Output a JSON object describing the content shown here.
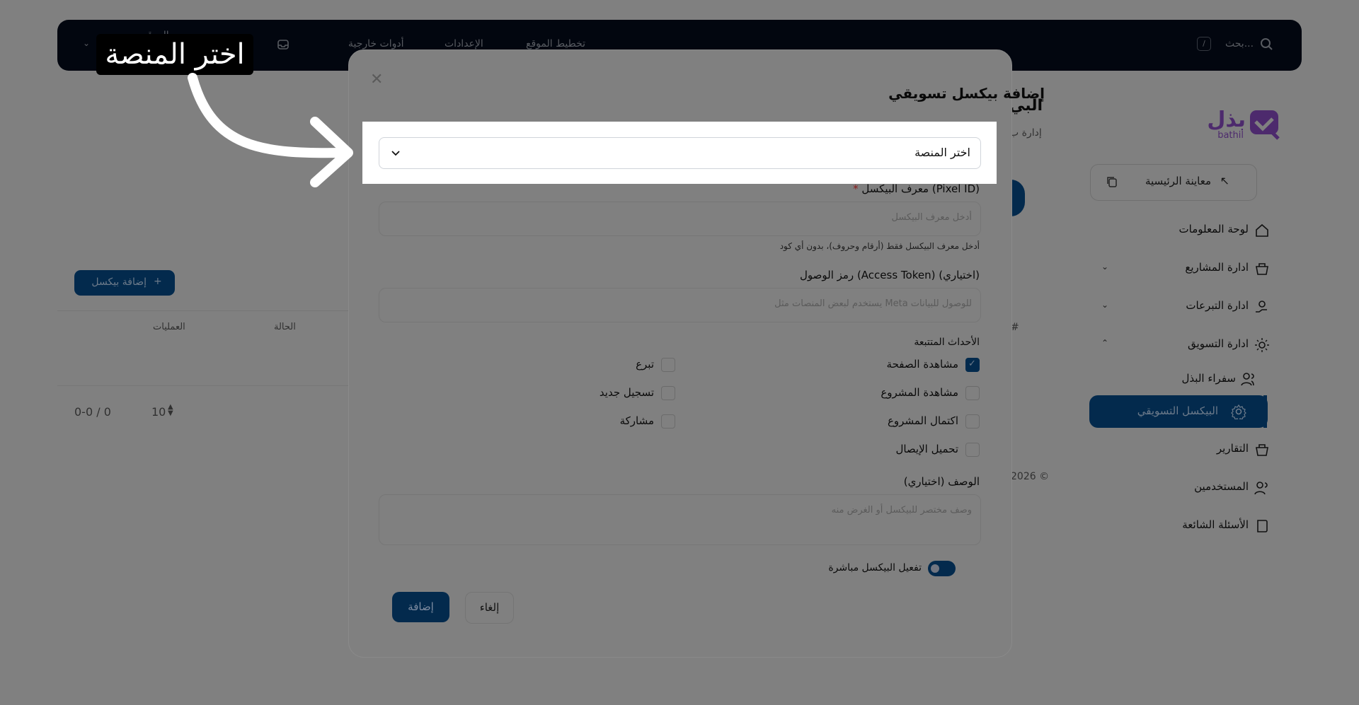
{
  "topbar": {
    "search_placeholder": "بحث...",
    "search_shortcut": "/",
    "nav_site_planning": "تخطيط الموقع",
    "nav_settings": "الإعدادات",
    "nav_external_tools": "أدوات خارجية",
    "user_label": "مدير الموقع"
  },
  "sidebar": {
    "brand_name": "بذل",
    "brand_sub": "bathil",
    "preview_home": "معاينة الرئيسية",
    "items": [
      {
        "label": "لوحة المعلومات"
      },
      {
        "label": "ادارة المشاريع"
      },
      {
        "label": "ادارة التبرعات"
      },
      {
        "label": "ادارة التسويق"
      },
      {
        "label": "سفراء البذل"
      },
      {
        "label": "البيكسل التسويقي"
      },
      {
        "label": "التقارير"
      },
      {
        "label": "المستخدمين"
      },
      {
        "label": "الأسئلة الشائعة"
      }
    ]
  },
  "background_page": {
    "title_fragment": "البي",
    "subtitle_fragment": "إدارة ب",
    "add_pixel_button": "إضافة بيكسل",
    "col_actions": "العمليات",
    "col_status": "الحالة",
    "col_hash": "#",
    "pagination_range": "0-0 / 0",
    "page_size": "10",
    "footer_year": "2026 ©"
  },
  "modal": {
    "title": "إضافة بيكسل تسويقي",
    "platform_select_value": "اختر المنصة",
    "pixel_id_label": "معرف البيكسل (Pixel ID)",
    "required_mark": "*",
    "pixel_id_placeholder": "أدخل معرف البيكسل",
    "pixel_id_hint": "أدخل معرف البيكسل فقط (أرقام وحروف)، بدون أي كود",
    "access_token_label": "رمز الوصول (Access Token) (اختياري)",
    "access_token_placeholder": "يستخدم لبعض المنصات مثل Meta للوصول للبيانات",
    "events_label": "الأحداث المتتبعة",
    "events": [
      {
        "label": "مشاهدة الصفحة",
        "checked": true
      },
      {
        "label": "تبرع",
        "checked": false
      },
      {
        "label": "مشاهدة المشروع",
        "checked": false
      },
      {
        "label": "تسجيل جديد",
        "checked": false
      },
      {
        "label": "اكتمال المشروع",
        "checked": false
      },
      {
        "label": "مشاركة",
        "checked": false
      },
      {
        "label": "تحميل الإيصال",
        "checked": false
      }
    ],
    "description_label": "الوصف (اختياري)",
    "description_placeholder": "وصف مختصر للبيكسل أو الغرض منه",
    "activate_label": "تفعيل البيكسل مباشرة",
    "activate_on": true,
    "add_button": "إضافة",
    "cancel_button": "إلغاء"
  },
  "annotation": {
    "callout_text": "اختر المنصة"
  },
  "colors": {
    "overlay": "#808080",
    "primary": "#032a4d",
    "topbar": "#02060f"
  }
}
